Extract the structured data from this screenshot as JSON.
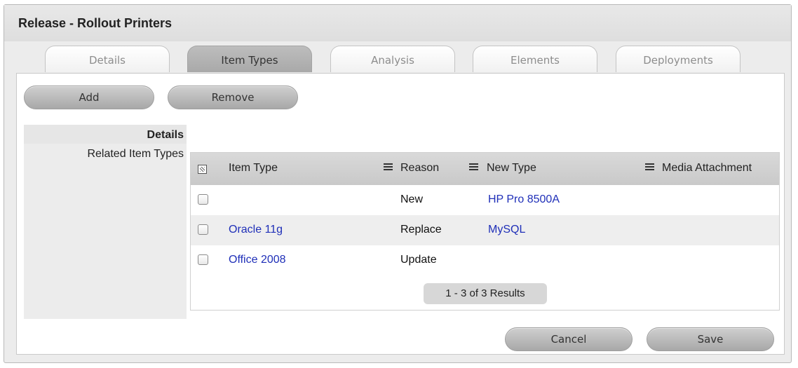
{
  "window": {
    "title": "Release - Rollout Printers"
  },
  "tabs": [
    {
      "label": "Details"
    },
    {
      "label": "Item Types"
    },
    {
      "label": "Analysis"
    },
    {
      "label": "Elements"
    },
    {
      "label": "Deployments"
    }
  ],
  "toolbar": {
    "add_label": "Add",
    "remove_label": "Remove"
  },
  "left_panel": {
    "title": "Details",
    "row_label": "Related Item Types"
  },
  "table": {
    "columns": [
      "Item Type",
      "Reason",
      "New Type",
      "Media Attachment"
    ],
    "rows": [
      {
        "item_type": "",
        "reason": "New",
        "new_type": "HP Pro 8500A"
      },
      {
        "item_type": "Oracle 11g",
        "reason": "Replace",
        "new_type": "MySQL"
      },
      {
        "item_type": "Office 2008",
        "reason": "Update",
        "new_type": ""
      }
    ],
    "pagination": "1 - 3 of 3 Results"
  },
  "footer": {
    "cancel_label": "Cancel",
    "save_label": "Save"
  },
  "colors": {
    "link": "#1f2fb8",
    "active_tab": "#b3b3b3"
  }
}
